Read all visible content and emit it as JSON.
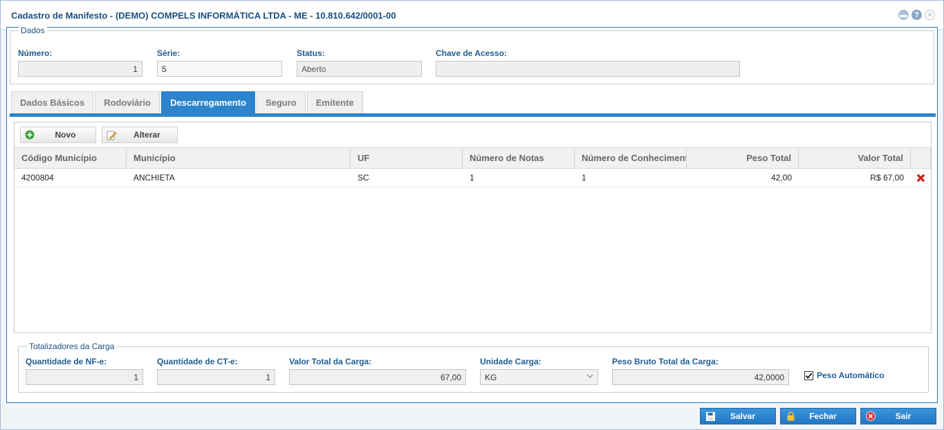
{
  "window": {
    "title": "Cadastro de Manifesto - (DEMO) COMPELS INFORMÁTICA LTDA - ME - 10.810.642/0001-00"
  },
  "dados": {
    "legend": "Dados",
    "numero_label": "Número:",
    "numero_value": "1",
    "serie_label": "Série:",
    "serie_value": "5",
    "status_label": "Status:",
    "status_value": "Aberto",
    "chave_label": "Chave de Acesso:",
    "chave_value": ""
  },
  "tabs": [
    {
      "label": "Dados Básicos",
      "active": false
    },
    {
      "label": "Rodoviário",
      "active": false
    },
    {
      "label": "Descarregamento",
      "active": true
    },
    {
      "label": "Seguro",
      "active": false
    },
    {
      "label": "Emitente",
      "active": false
    }
  ],
  "toolbar": {
    "novo_label": "Novo",
    "alterar_label": "Alterar"
  },
  "grid": {
    "columns": [
      "Código Município",
      "Município",
      "UF",
      "Número de Notas",
      "Número de Conhecimento",
      "Peso Total",
      "Valor Total"
    ],
    "rows": [
      {
        "codigo": "4200804",
        "municipio": "ANCHIETA",
        "uf": "SC",
        "notas": "1",
        "conhecimentos": "1",
        "peso": "42,00",
        "valor": "R$ 67,00"
      }
    ]
  },
  "totalizadores": {
    "legend": "Totalizadores da Carga",
    "qtd_nfe_label": "Quantidade de NF-e:",
    "qtd_nfe_value": "1",
    "qtd_cte_label": "Quantidade de CT-e:",
    "qtd_cte_value": "1",
    "valor_total_label": "Valor Total da Carga:",
    "valor_total_value": "67,00",
    "unidade_label": "Unidade Carga:",
    "unidade_value": "KG",
    "peso_bruto_label": "Peso Bruto Total da Carga:",
    "peso_bruto_value": "42,0000",
    "peso_auto_label": "Peso Automático",
    "peso_auto_checked": true
  },
  "footer": {
    "salvar_label": "Salvar",
    "fechar_label": "Fechar",
    "sair_label": "Sair"
  },
  "colors": {
    "accent": "#2b84cc",
    "label": "#1e5c94",
    "title": "#1b4f80",
    "delete": "#e02020"
  }
}
